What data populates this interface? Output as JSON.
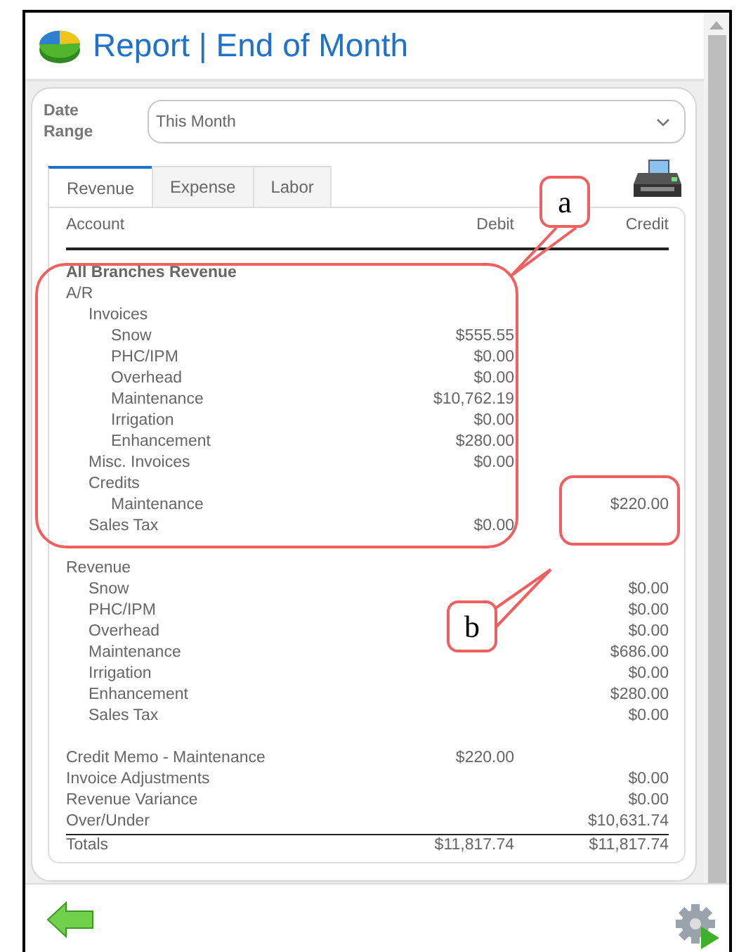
{
  "header": {
    "title": "Report | End of Month"
  },
  "filters": {
    "label": "Date Range",
    "date_range": "This Month"
  },
  "tabs": [
    {
      "label": "Revenue",
      "selected": true
    },
    {
      "label": "Expense",
      "selected": false
    },
    {
      "label": "Labor",
      "selected": false
    }
  ],
  "table": {
    "columns": [
      "Account",
      "Debit",
      "Credit"
    ],
    "sections": [
      {
        "title": "All Branches Revenue",
        "rows": [
          {
            "account": "A/R",
            "children": [
              {
                "account": "Invoices",
                "children": [
                  {
                    "account": "Snow",
                    "debit": "$555.55"
                  },
                  {
                    "account": "PHC/IPM",
                    "debit": "$0.00"
                  },
                  {
                    "account": "Overhead",
                    "debit": "$0.00"
                  },
                  {
                    "account": "Maintenance",
                    "debit": "$10,762.19"
                  },
                  {
                    "account": "Irrigation",
                    "debit": "$0.00"
                  },
                  {
                    "account": "Enhancement",
                    "debit": "$280.00"
                  }
                ]
              },
              {
                "account": "Misc. Invoices",
                "debit": "$0.00"
              },
              {
                "account": "Credits",
                "children": [
                  {
                    "account": "Maintenance",
                    "credit": "$220.00"
                  }
                ]
              },
              {
                "account": "Sales Tax",
                "debit": "$0.00"
              }
            ]
          }
        ]
      },
      {
        "rows": [
          {
            "account": "Revenue",
            "children": [
              {
                "account": "Snow",
                "credit": "$0.00"
              },
              {
                "account": "PHC/IPM",
                "credit": "$0.00"
              },
              {
                "account": "Overhead",
                "credit": "$0.00"
              },
              {
                "account": "Maintenance",
                "credit": "$686.00"
              },
              {
                "account": "Irrigation",
                "credit": "$0.00"
              },
              {
                "account": "Enhancement",
                "credit": "$280.00"
              },
              {
                "account": "Sales Tax",
                "credit": "$0.00"
              }
            ]
          }
        ]
      },
      {
        "rows": [
          {
            "account": "Credit Memo - Maintenance",
            "debit": "$220.00"
          },
          {
            "account": "Invoice Adjustments",
            "credit": "$0.00"
          },
          {
            "account": "Revenue Variance",
            "credit": "$0.00"
          },
          {
            "account": "Over/Under",
            "credit": "$10,631.74"
          }
        ]
      }
    ],
    "totals": {
      "account": "Totals",
      "debit": "$11,817.74",
      "credit": "$11,817.74"
    }
  },
  "callouts": [
    {
      "label": "a"
    },
    {
      "label": "b"
    }
  ]
}
